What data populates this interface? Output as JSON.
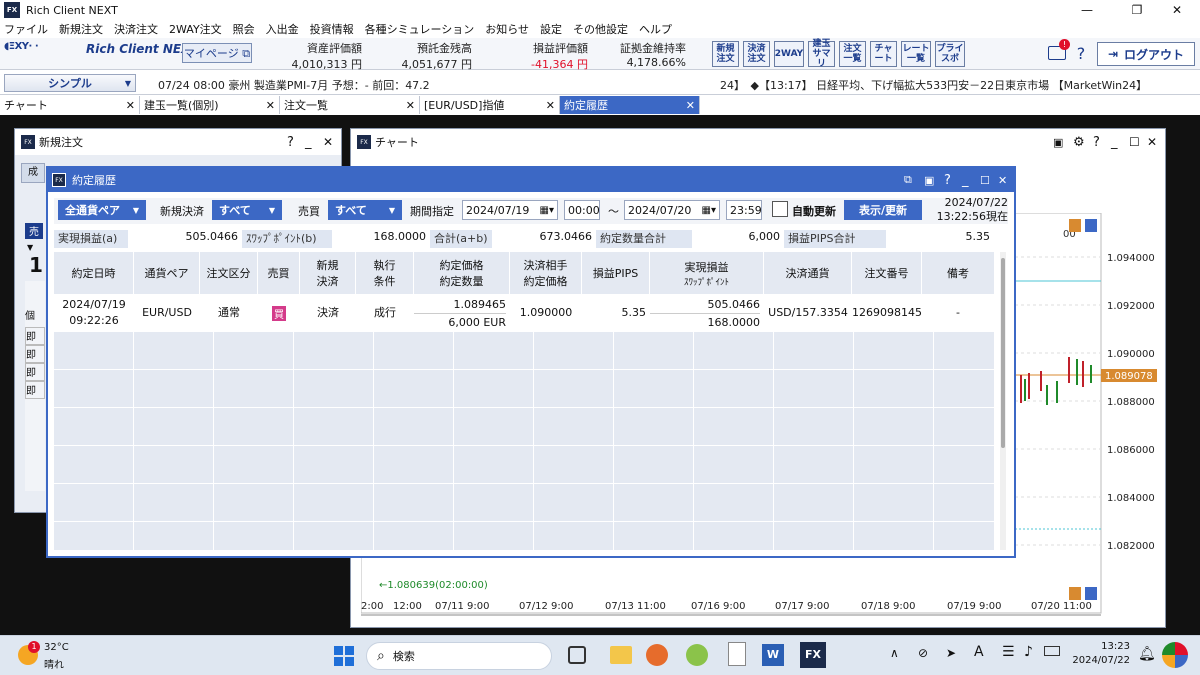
{
  "window": {
    "title": "Rich Client NEXT",
    "fx_badge": "FX"
  },
  "menu": [
    "ファイル",
    "新規注文",
    "決済注文",
    "2WAY注文",
    "照会",
    "入出金",
    "投資情報",
    "各種シミュレーション",
    "お知らせ",
    "設定",
    "その他設定",
    "ヘルプ"
  ],
  "toolbar": {
    "logo_text": "Rich Client NEXT",
    "mypage": "マイページ ⧉",
    "metrics": [
      {
        "label": "資産評価額",
        "value": "4,010,313 円"
      },
      {
        "label": "預託金残高",
        "value": "4,051,677 円"
      },
      {
        "label": "損益評価額",
        "value": "-41,364 円"
      },
      {
        "label": "証拠金維持率",
        "value": "4,178.66%"
      }
    ],
    "buttons": [
      {
        "l1": "新規",
        "l2": "注文"
      },
      {
        "l1": "決済",
        "l2": "注文"
      },
      {
        "l1": "2WAY",
        "l2": ""
      },
      {
        "l1": "建玉",
        "l2": "サマリ"
      },
      {
        "l1": "注文",
        "l2": "一覧"
      },
      {
        "l1": "チャ",
        "l2": "ート"
      },
      {
        "l1": "レート",
        "l2": "一覧"
      },
      {
        "l1": "プライ",
        "l2": "スボ"
      }
    ],
    "logout": "ログアウト",
    "notification_badge": "!"
  },
  "status": {
    "simple_select": "シンプル",
    "ticker_left": "07/24 08:00 豪州 製造業PMI-7月 予想：- 前回：47.2",
    "ticker_right": "24】　◆【13:17】 日経平均、下げ幅拡大533円安－22日東京市場 【MarketWin24】"
  },
  "tabs": [
    "チャート",
    "建玉一覧(個別)",
    "注文一覧",
    "[EUR/USD]指値",
    "約定履歴"
  ],
  "neworder": {
    "title": "新規注文",
    "help": "?",
    "min": "_",
    "close": "✕",
    "side_label": "売",
    "qty_digit": "1",
    "partial_label": "成",
    "rows_label": "個",
    "row_prefix": "即"
  },
  "chart": {
    "title": "チャート",
    "price_ticks": [
      "1.094000",
      "1.092000",
      "1.090000",
      "1.088000",
      "1.086000",
      "1.084000",
      "1.082000"
    ],
    "current_price": "1.089078",
    "low_marker": "←1.080639(02:00:00)",
    "level_label": "00",
    "x_ticks": [
      "2:00",
      "12:00",
      "07/11 9:00",
      "07/12 9:00",
      "07/13 11:00",
      "07/16 9:00",
      "07/17 9:00",
      "07/18 9:00",
      "07/19 9:00",
      "07/20 11:00"
    ]
  },
  "history": {
    "title": "約定履歴",
    "filters": {
      "currency": "全通貨ペア",
      "newclose_label": "新規決済",
      "newclose": "すべて",
      "side_label": "売買",
      "side": "すべて",
      "period_label": "期間指定",
      "from_date": "2024/07/19",
      "from_time": "00:00",
      "tilde": "～",
      "to_date": "2024/07/20",
      "to_time": "23:59",
      "auto_refresh": "自動更新",
      "refresh_btn": "表示/更新",
      "as_of_date": "2024/07/22",
      "as_of_time": "13:22:56現在"
    },
    "summary": [
      {
        "label": "実現損益(a)",
        "value": "505.0466"
      },
      {
        "label": "ｽﾜｯﾌﾟﾎﾟｲﾝﾄ(b)",
        "value": "168.0000"
      },
      {
        "label": "合計(a+b)",
        "value": "673.0466"
      },
      {
        "label": "約定数量合計",
        "value": "6,000"
      },
      {
        "label": "損益PIPS合計",
        "value": "5.35"
      }
    ],
    "columns": [
      {
        "l1": "約定日時",
        "l2": ""
      },
      {
        "l1": "通貨ペア",
        "l2": ""
      },
      {
        "l1": "注文区分",
        "l2": ""
      },
      {
        "l1": "売買",
        "l2": ""
      },
      {
        "l1": "新規",
        "l2": "決済"
      },
      {
        "l1": "執行",
        "l2": "条件"
      },
      {
        "l1": "約定価格",
        "l2": "約定数量"
      },
      {
        "l1": "決済相手",
        "l2": "約定価格"
      },
      {
        "l1": "損益PIPS",
        "l2": ""
      },
      {
        "l1": "実現損益",
        "l2": "ｽﾜｯﾌﾟﾎﾟｲﾝﾄ"
      },
      {
        "l1": "決済通貨",
        "l2": ""
      },
      {
        "l1": "注文番号",
        "l2": ""
      },
      {
        "l1": "備考",
        "l2": ""
      }
    ],
    "row": {
      "date": "2024/07/19",
      "time": "09:22:26",
      "pair": "EUR/USD",
      "order_type": "通常",
      "side": "買",
      "newclose": "決済",
      "exec": "成行",
      "price": "1.089465",
      "qty": "6,000 EUR",
      "counter_price": "1.090000",
      "pips": "5.35",
      "pnl": "505.0466",
      "swap": "168.0000",
      "settle_ccy": "USD/157.3354",
      "order_no": "1269098145",
      "note": "-"
    }
  },
  "taskbar": {
    "temp": "32°C",
    "weather": "晴れ",
    "weather_badge": "1",
    "search": "検索",
    "time": "13:23",
    "date": "2024/07/22",
    "ime": "A"
  },
  "colors": {
    "accent": "#3c68c5",
    "brand": "#1c3c8c",
    "negative": "#e0102a",
    "buy": "#d43b8a"
  }
}
